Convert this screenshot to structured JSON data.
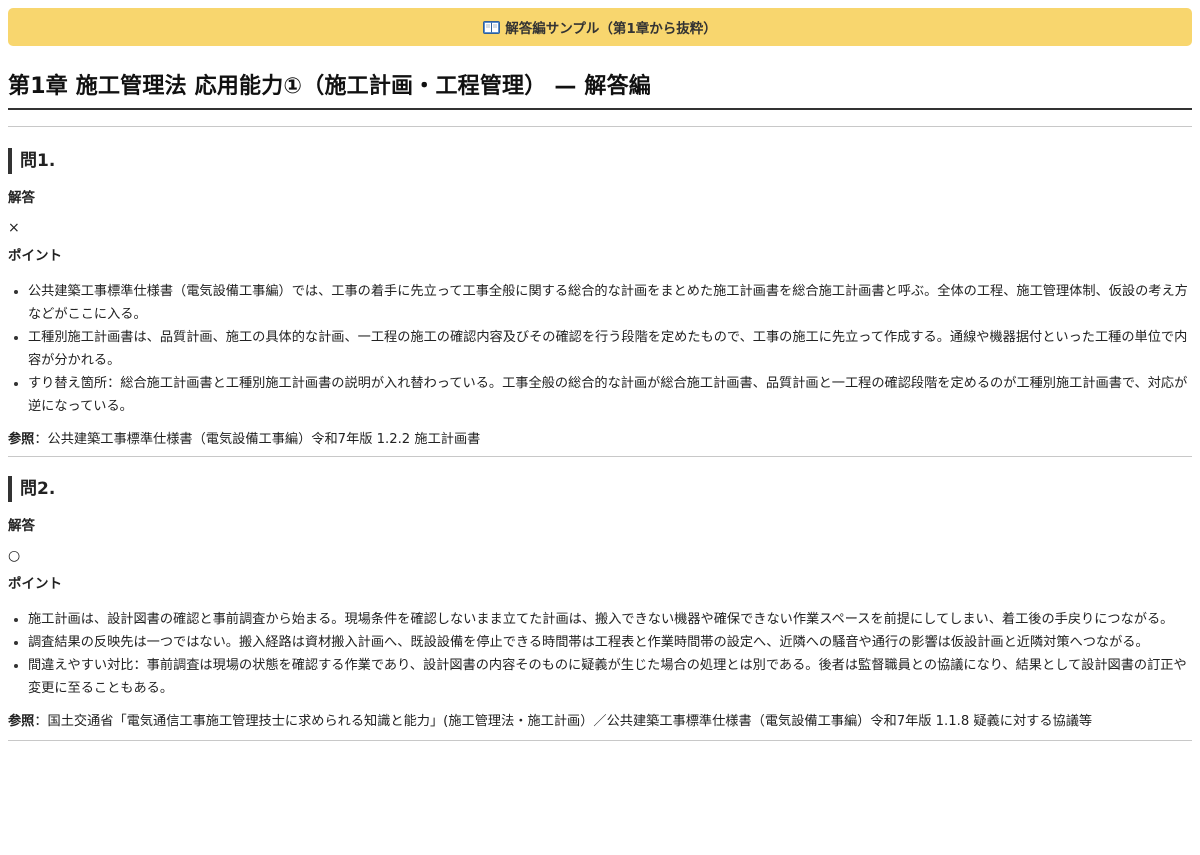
{
  "banner": {
    "icon": "book-icon",
    "text": "解答編サンプル（第1章から抜粋）",
    "color": "#f8d66e"
  },
  "chapter_title": "第1章 施工管理法 応用能力①（施工計画・工程管理） — 解答編",
  "questions": [
    {
      "title": "問1.",
      "answer_label": "解答",
      "answer": "×",
      "points_label": "ポイント",
      "points": [
        "公共建築工事標準仕様書（電気設備工事編）では、工事の着手に先立って工事全般に関する総合的な計画をまとめた施工計画書を総合施工計画書と呼ぶ。全体の工程、施工管理体制、仮設の考え方などがここに入る。",
        "工種別施工計画書は、品質計画、施工の具体的な計画、一工程の施工の確認内容及びその確認を行う段階を定めたもので、工事の施工に先立って作成する。通線や機器据付といった工種の単位で内容が分かれる。",
        "すり替え箇所：総合施工計画書と工種別施工計画書の説明が入れ替わっている。工事全般の総合的な計画が総合施工計画書、品質計画と一工程の確認段階を定めるのが工種別施工計画書で、対応が逆になっている。"
      ],
      "ref_label": "参照",
      "ref_text": "：公共建築工事標準仕様書（電気設備工事編）令和7年版 1.2.2 施工計画書"
    },
    {
      "title": "問2.",
      "answer_label": "解答",
      "answer": "○",
      "points_label": "ポイント",
      "points": [
        "施工計画は、設計図書の確認と事前調査から始まる。現場条件を確認しないまま立てた計画は、搬入できない機器や確保できない作業スペースを前提にしてしまい、着工後の手戻りにつながる。",
        "調査結果の反映先は一つではない。搬入経路は資材搬入計画へ、既設設備を停止できる時間帯は工程表と作業時間帯の設定へ、近隣への騒音や通行の影響は仮設計画と近隣対策へつながる。",
        "間違えやすい対比：事前調査は現場の状態を確認する作業であり、設計図書の内容そのものに疑義が生じた場合の処理とは別である。後者は監督職員との協議になり、結果として設計図書の訂正や変更に至ることもある。"
      ],
      "ref_label": "参照",
      "ref_text": "：国土交通省「電気通信工事施工管理技士に求められる知識と能力」(施工管理法・施工計画）／公共建築工事標準仕様書（電気設備工事編）令和7年版 1.1.8 疑義に対する協議等"
    }
  ]
}
